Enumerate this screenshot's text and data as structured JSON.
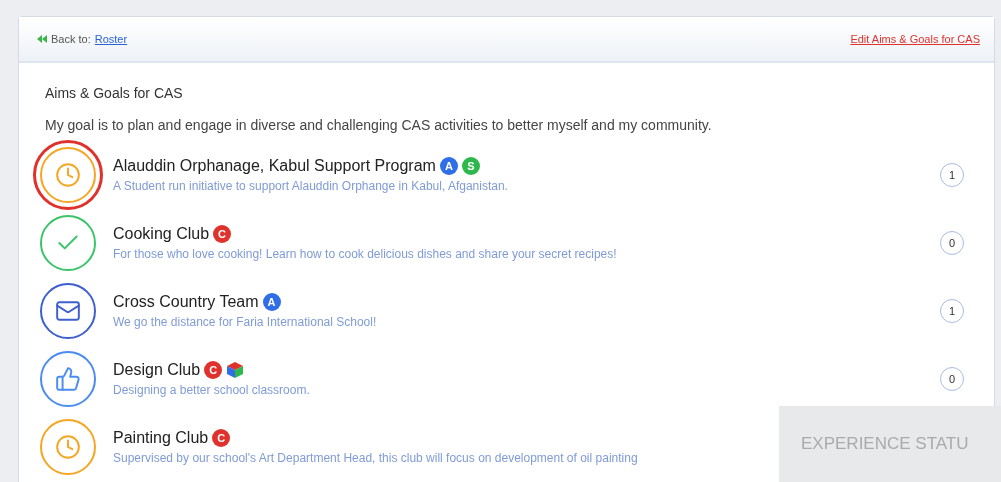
{
  "header": {
    "back_label": "Back to:",
    "back_link": "Roster",
    "edit_link": "Edit Aims & Goals for CAS"
  },
  "title": "Aims & Goals for CAS",
  "goal": "My goal is to plan and engage in diverse and challenging CAS activities to better myself and my community.",
  "activities": [
    {
      "kind": "clock",
      "color": "#f5a623",
      "highlighted": true,
      "name": "Alauddin Orphanage, Kabul Support Program",
      "badges": [
        {
          "kind": "letter",
          "label": "A",
          "color": "#2f6ee6"
        },
        {
          "kind": "letter",
          "label": "S",
          "color": "#2db84d"
        }
      ],
      "description": "A Student run initiative to support Alauddin Orphange in Kabul, Afganistan.",
      "comments": "1"
    },
    {
      "kind": "check",
      "color": "#3cc46a",
      "highlighted": false,
      "name": "Cooking Club",
      "badges": [
        {
          "kind": "letter",
          "label": "C",
          "color": "#e0322d"
        }
      ],
      "description": "For those who love cooking! Learn how to cook delicious dishes and share your secret recipes!",
      "comments": "0"
    },
    {
      "kind": "mail",
      "color": "#3f5fcf",
      "highlighted": false,
      "name": "Cross Country Team",
      "badges": [
        {
          "kind": "letter",
          "label": "A",
          "color": "#2f6ee6"
        }
      ],
      "description": "We go the distance for Faria International School!",
      "comments": "1"
    },
    {
      "kind": "thumb",
      "color": "#4a8cf0",
      "highlighted": false,
      "name": "Design Club",
      "badges": [
        {
          "kind": "letter",
          "label": "C",
          "color": "#e0322d"
        },
        {
          "kind": "cube"
        }
      ],
      "description": "Designing a better school classroom.",
      "comments": "0"
    },
    {
      "kind": "clock",
      "color": "#f5a623",
      "highlighted": false,
      "name": "Painting Club",
      "badges": [
        {
          "kind": "letter",
          "label": "C",
          "color": "#e0322d"
        }
      ],
      "description": "Supervised by our school's Art Department Head, this club will focus on development of oil painting"
    }
  ],
  "overlay_panel": {
    "title": "EXPERIENCE STATU"
  }
}
